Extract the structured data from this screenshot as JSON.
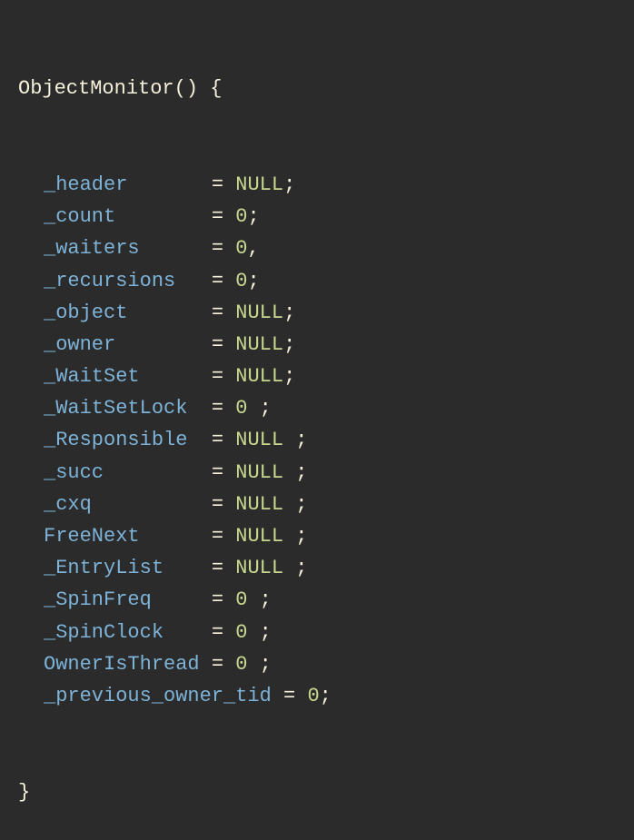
{
  "code": {
    "funcName": "ObjectMonitor",
    "openParen": "()",
    "openBrace": " {",
    "closeBrace": "}",
    "lines": [
      {
        "field": "_header",
        "pad": "       ",
        "val": "NULL",
        "term": ";"
      },
      {
        "field": "_count",
        "pad": "        ",
        "val": "0",
        "term": ";"
      },
      {
        "field": "_waiters",
        "pad": "      ",
        "val": "0",
        "term": ","
      },
      {
        "field": "_recursions",
        "pad": "   ",
        "val": "0",
        "term": ";"
      },
      {
        "field": "_object",
        "pad": "       ",
        "val": "NULL",
        "term": ";"
      },
      {
        "field": "_owner",
        "pad": "        ",
        "val": "NULL",
        "term": ";"
      },
      {
        "field": "_WaitSet",
        "pad": "      ",
        "val": "NULL",
        "term": ";"
      },
      {
        "field": "_WaitSetLock",
        "pad": "  ",
        "val": "0",
        "term": " ;"
      },
      {
        "field": "_Responsible",
        "pad": "  ",
        "val": "NULL",
        "term": " ;"
      },
      {
        "field": "_succ",
        "pad": "         ",
        "val": "NULL",
        "term": " ;"
      },
      {
        "field": "_cxq",
        "pad": "          ",
        "val": "NULL",
        "term": " ;"
      },
      {
        "field": "FreeNext",
        "pad": "      ",
        "val": "NULL",
        "term": " ;"
      },
      {
        "field": "_EntryList",
        "pad": "    ",
        "val": "NULL",
        "term": " ;"
      },
      {
        "field": "_SpinFreq",
        "pad": "     ",
        "val": "0",
        "term": " ;"
      },
      {
        "field": "_SpinClock",
        "pad": "    ",
        "val": "0",
        "term": " ;"
      },
      {
        "field": "OwnerIsThread",
        "pad": " ",
        "val": "0",
        "term": " ;"
      },
      {
        "field": "_previous_owner_tid",
        "pad": " ",
        "val": "0",
        "term": ";",
        "nopad2": true
      }
    ]
  }
}
